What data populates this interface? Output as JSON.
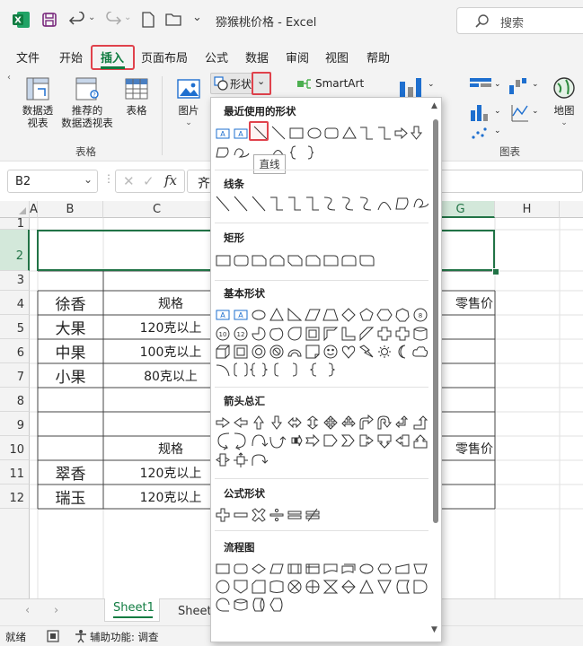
{
  "titlebar": {
    "title": "猕猴桃价格  -  Excel",
    "search_placeholder": "搜索"
  },
  "menu": {
    "tabs": [
      "文件",
      "开始",
      "插入",
      "页面布局",
      "公式",
      "数据",
      "审阅",
      "视图",
      "帮助"
    ],
    "active": "插入"
  },
  "ribbon": {
    "pivot_label1": "数据透",
    "pivot_label2": "视表",
    "rec_pivot_label1": "推荐的",
    "rec_pivot_label2": "数据透视表",
    "table_label": "表格",
    "group_tables": "表格",
    "pictures_label": "图片",
    "shapes_label": "形状",
    "smartart_label": "SmartArt",
    "charts_group": "图表",
    "map_label": "地图"
  },
  "formula_bar": {
    "name_box": "B2",
    "content": "齐"
  },
  "columns": [
    "A",
    "B",
    "C",
    "G",
    "H"
  ],
  "rows": [
    "1",
    "2",
    "3",
    "4",
    "5",
    "6",
    "7",
    "8",
    "9",
    "10",
    "11",
    "12"
  ],
  "cells": {
    "b4": "徐香",
    "c4": "规格",
    "g4": "零售价",
    "b5": "大果",
    "c5": "120克以上",
    "b6": "中果",
    "c6": "100克以上",
    "b7": "小果",
    "c7": "80克以上",
    "c10": "规格",
    "g10": "零售价",
    "b11": "翠香",
    "c11": "120克以上",
    "b12": "瑞玉",
    "c12": "120克以上"
  },
  "sheet_tabs": [
    "Sheet1",
    "Sheet"
  ],
  "status": {
    "ready": "就绪",
    "accessibility": "辅助功能: 调查"
  },
  "shapes_menu": {
    "recent": "最近使用的形状",
    "lines": "线条",
    "rectangles": "矩形",
    "basic": "基本形状",
    "arrows": "箭头总汇",
    "equation": "公式形状",
    "flowchart": "流程图",
    "tooltip": "直线"
  },
  "colors": {
    "excel_green": "#107c41",
    "highlight_red": "#e0424c",
    "selection_green": "#217346",
    "shape_stroke": "#333333",
    "accent_blue": "#1e6fcf"
  }
}
